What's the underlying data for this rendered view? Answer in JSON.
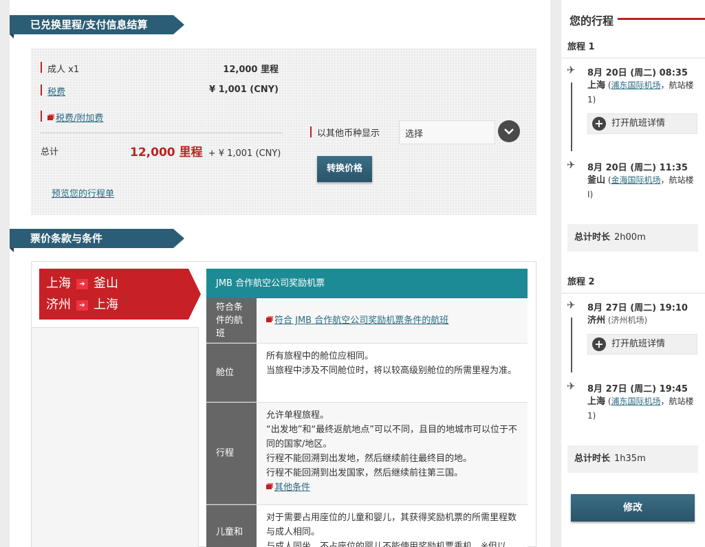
{
  "payment": {
    "header": "已兑换里程/支付信息结算",
    "adult_label": "成人 x1",
    "adult_value": "12,000 里程",
    "tax_label": "税费",
    "tax_value": "¥ 1,001 (CNY)",
    "surcharge_link": "税费/附加费",
    "total_label": "总计",
    "total_miles": "12,000 里程",
    "total_plus": "+ ¥ 1,001 (CNY)",
    "currency_label": "以其他币种显示",
    "currency_select": "选择",
    "convert_button": "转换价格",
    "preview_link": "预览您的行程单"
  },
  "fare": {
    "header": "票价条款与条件",
    "routes": [
      {
        "from": "上海",
        "to": "釜山"
      },
      {
        "from": "济州",
        "to": "上海"
      }
    ],
    "title": "JMB 合作航空公司奖励机票",
    "rows": [
      {
        "key": "符合条件的航班",
        "link": "符合 JMB 合作航空公司奖励机票条件的航班"
      },
      {
        "key": "舱位",
        "lines": [
          "所有旅程中的舱位应相同。",
          "当旅程中涉及不同舱位时，将以较高级别舱位的所需里程为准。"
        ]
      },
      {
        "key": "行程",
        "lines": [
          "允许单程旅程。",
          "“出发地”和“最终返航地点”可以不同，且目的地城市可以位于不同的国家/地区。",
          "行程不能回溯到出发地，然后继续前往最终目的地。",
          "行程不能回溯到出发国家，然后继续前往第三国。"
        ],
        "link": "其他条件"
      },
      {
        "key": "儿童和",
        "lines": [
          "对于需要占用座位的儿童和婴儿，其获得奖励机票的所需里程数与成人相同。",
          "与成人同坐、不占座位的婴儿不能使用奖励机票乘机。※但以"
        ]
      }
    ]
  },
  "itinerary": {
    "title": "您的行程",
    "legs": [
      {
        "title": "旅程 1",
        "dep_time": "8月 20日 (周二) 08:35",
        "dep_city": "上海",
        "dep_airport": "浦东国际机场",
        "dep_terminal_a": "，航站楼",
        "dep_terminal_b": "1)",
        "detail_button": "打开航班详情",
        "arr_time": "8月 20日 (周二) 11:35",
        "arr_city": "釜山",
        "arr_airport": "金海国际机场",
        "arr_terminal_a": "，航站楼",
        "arr_terminal_b": "I)",
        "duration_label": "总计时长",
        "duration": "2h00m"
      },
      {
        "title": "旅程 2",
        "dep_time": "8月 27日 (周二) 19:10",
        "dep_city": "济州",
        "dep_airport_plain": "(济州机场)",
        "detail_button": "打开航班详情",
        "arr_time": "8月 27日 (周二) 19:45",
        "arr_city": "上海",
        "arr_airport": "浦东国际机场",
        "arr_terminal_a": "，航站楼",
        "arr_terminal_b": "1)",
        "duration_label": "总计时长",
        "duration": "1h35m"
      }
    ],
    "modify_button": "修改"
  }
}
